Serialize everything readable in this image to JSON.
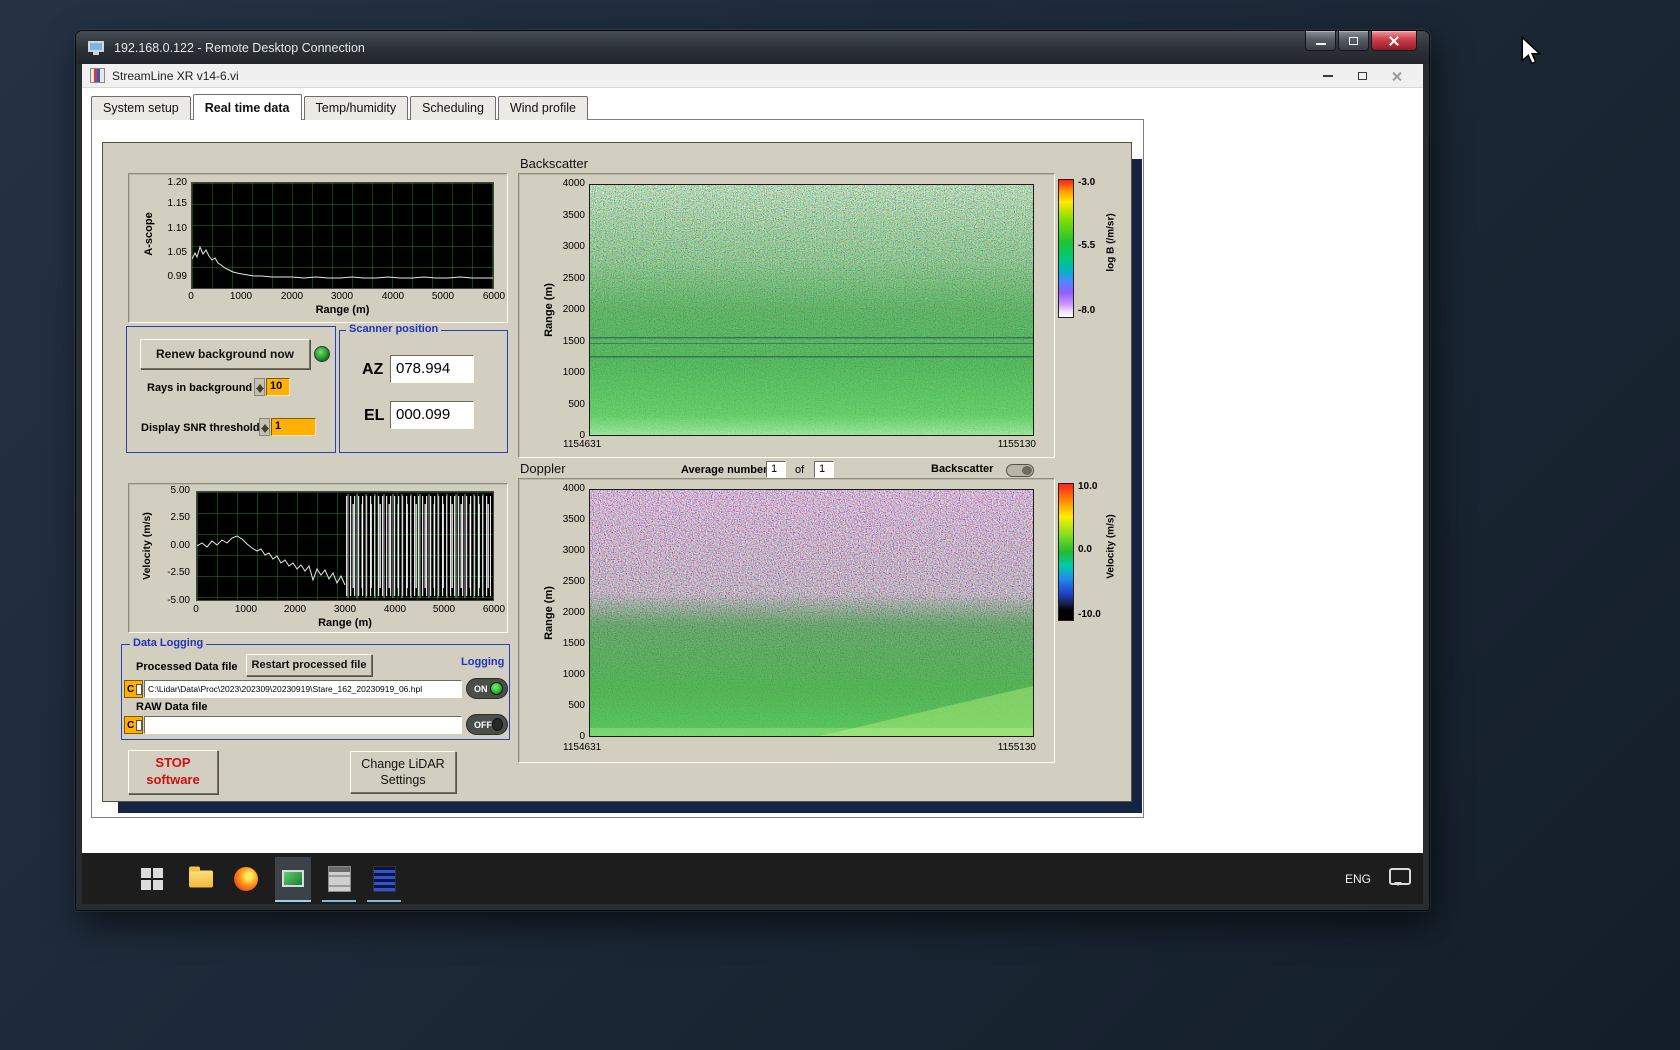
{
  "rdp": {
    "title": "192.168.0.122 - Remote Desktop Connection"
  },
  "app": {
    "title": "StreamLine XR v14-6.vi",
    "tabs": [
      {
        "label": "System setup"
      },
      {
        "label": "Real time data"
      },
      {
        "label": "Temp/humidity"
      },
      {
        "label": "Scheduling"
      },
      {
        "label": "Wind profile"
      }
    ]
  },
  "ascope": {
    "ylabel": "A-scope",
    "xlabel": "Range (m)",
    "y_ticks": [
      "1.20",
      "1.15",
      "1.10",
      "1.05",
      "0.99"
    ],
    "x_ticks": [
      "0",
      "1000",
      "2000",
      "3000",
      "4000",
      "5000",
      "6000"
    ]
  },
  "background_group": {
    "renew_button": "Renew background now",
    "rays_label": "Rays in background",
    "rays_value": "10",
    "snr_label": "Display SNR threshold",
    "snr_value": "1"
  },
  "scanner": {
    "title": "Scanner position",
    "az_label": "AZ",
    "az_value": "078.994",
    "el_label": "EL",
    "el_value": "000.099"
  },
  "backscatter": {
    "title": "Backscatter",
    "ylabel": "Range (m)",
    "y_ticks": [
      "4000",
      "3500",
      "3000",
      "2500",
      "2000",
      "1500",
      "1000",
      "500",
      "0"
    ],
    "x_left": "1154631",
    "x_right": "1155130",
    "colorbar_label": "log B (/m/sr)",
    "colorbar_ticks": [
      "-3.0",
      "-5.5",
      "-8.0"
    ]
  },
  "doppler": {
    "title": "Doppler",
    "average_label": "Average number",
    "average_value": "1",
    "of_label": "of",
    "of_value": "1",
    "toggle_label": "Backscatter",
    "ylabel": "Range (m)",
    "y_ticks": [
      "4000",
      "3500",
      "3000",
      "2500",
      "2000",
      "1500",
      "1000",
      "500",
      "0"
    ],
    "x_left": "1154631",
    "x_right": "1155130",
    "colorbar_label": "Velocity (m/s)",
    "colorbar_ticks": [
      "10.0",
      "0.0",
      "-10.0"
    ]
  },
  "velocity": {
    "ylabel": "Velocity (m/s)",
    "xlabel": "Range (m)",
    "y_ticks": [
      "5.00",
      "2.50",
      "0.00",
      "-2.50",
      "-5.00"
    ],
    "x_ticks": [
      "0",
      "1000",
      "2000",
      "3000",
      "4000",
      "5000",
      "6000"
    ]
  },
  "logging": {
    "title": "Data Logging",
    "processed_label": "Processed Data file",
    "restart_button": "Restart processed file",
    "logging_label": "Logging",
    "drive": "C",
    "processed_path": "C:\\Lidar\\Data\\Proc\\2023\\202309\\20230919\\Stare_162_20230919_06.hpl",
    "on_label": "ON",
    "raw_label": "RAW Data file",
    "raw_path": "",
    "off_label": "OFF"
  },
  "actions": {
    "stop_line1": "STOP",
    "stop_line2": "software",
    "change_line1": "Change LiDAR",
    "change_line2": "Settings"
  },
  "taskbar": {
    "language": "ENG"
  },
  "colors": {
    "accent_orange": "#ffb000",
    "led_green": "#2dd62d",
    "panel_tan": "#d2cec0"
  }
}
